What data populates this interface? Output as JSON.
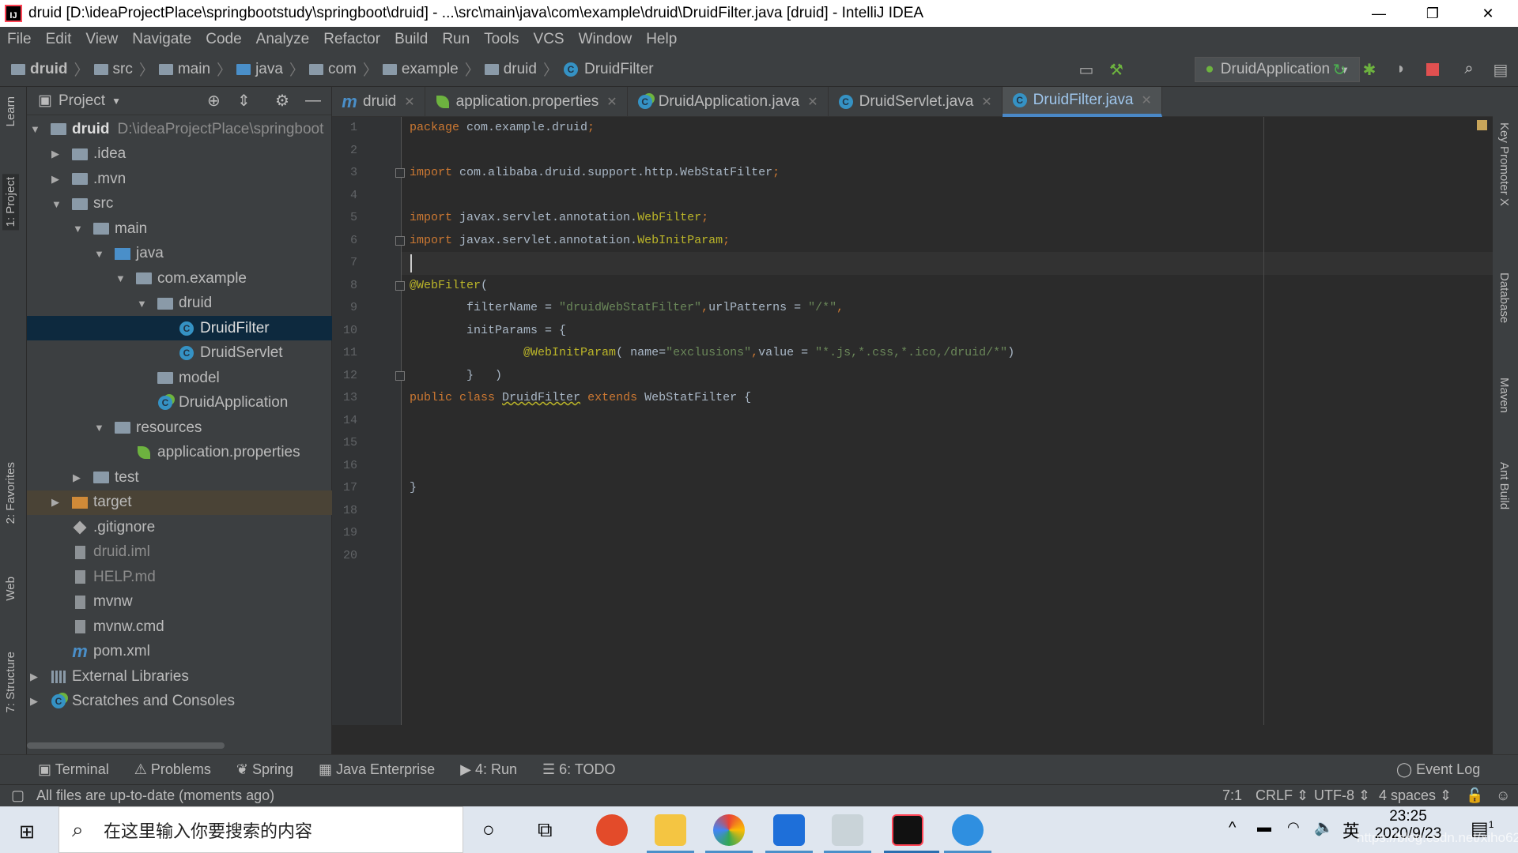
{
  "window": {
    "title": "druid [D:\\ideaProjectPlace\\springbootstudy\\springboot\\druid] - ...\\src\\main\\java\\com\\example\\druid\\DruidFilter.java [druid] - IntelliJ IDEA",
    "minimize": "—",
    "restore": "❐",
    "close": "✕"
  },
  "menu": [
    "File",
    "Edit",
    "View",
    "Navigate",
    "Code",
    "Analyze",
    "Refactor",
    "Build",
    "Run",
    "Tools",
    "VCS",
    "Window",
    "Help"
  ],
  "breadcrumbs": [
    "druid",
    "src",
    "main",
    "java",
    "com",
    "example",
    "druid",
    "DruidFilter"
  ],
  "run_config": "DruidApplication",
  "toolbar_icons": [
    "build-hammer-icon",
    "rerun-icon",
    "debug-icon",
    "coverage-icon",
    "stop-icon",
    "search-icon",
    "project-structure-icon"
  ],
  "left_strip": [
    "Learn",
    "1: Project",
    "2: Favorites",
    "Web",
    "7: Structure"
  ],
  "right_strip": [
    "Key Promoter X",
    "Database",
    "Maven",
    "Ant Build"
  ],
  "project": {
    "title": "Project",
    "tree": [
      {
        "d": 0,
        "a": "▼",
        "i": "folder",
        "label": "druid",
        "extra": "D:\\ideaProjectPlace\\springboot",
        "bold": true
      },
      {
        "d": 1,
        "a": "▶",
        "i": "folder",
        "label": ".idea"
      },
      {
        "d": 1,
        "a": "▶",
        "i": "folder",
        "label": ".mvn"
      },
      {
        "d": 1,
        "a": "▼",
        "i": "folder",
        "label": "src"
      },
      {
        "d": 2,
        "a": "▼",
        "i": "folder",
        "label": "main"
      },
      {
        "d": 3,
        "a": "▼",
        "i": "bfolder",
        "label": "java"
      },
      {
        "d": 4,
        "a": "▼",
        "i": "folder",
        "label": "com.example"
      },
      {
        "d": 5,
        "a": "▼",
        "i": "folder",
        "label": "druid"
      },
      {
        "d": 6,
        "a": "",
        "i": "cls",
        "label": "DruidFilter",
        "sel": true
      },
      {
        "d": 6,
        "a": "",
        "i": "cls",
        "label": "DruidServlet"
      },
      {
        "d": 5,
        "a": "",
        "i": "folder",
        "label": "model"
      },
      {
        "d": 5,
        "a": "",
        "i": "spring",
        "label": "DruidApplication"
      },
      {
        "d": 3,
        "a": "▼",
        "i": "folder",
        "label": "resources"
      },
      {
        "d": 4,
        "a": "",
        "i": "leaf",
        "label": "application.properties"
      },
      {
        "d": 2,
        "a": "▶",
        "i": "folder",
        "label": "test"
      },
      {
        "d": 1,
        "a": "▶",
        "i": "ofolder",
        "label": "target",
        "tgt": true
      },
      {
        "d": 1,
        "a": "",
        "i": "git",
        "label": ".gitignore"
      },
      {
        "d": 1,
        "a": "",
        "i": "file",
        "label": "druid.iml",
        "grey": true
      },
      {
        "d": 1,
        "a": "",
        "i": "file",
        "label": "HELP.md",
        "grey": true
      },
      {
        "d": 1,
        "a": "",
        "i": "file",
        "label": "mvnw"
      },
      {
        "d": 1,
        "a": "",
        "i": "file",
        "label": "mvnw.cmd"
      },
      {
        "d": 1,
        "a": "",
        "i": "m",
        "label": "pom.xml"
      },
      {
        "d": 0,
        "a": "▶",
        "i": "lib",
        "label": "External Libraries"
      },
      {
        "d": 0,
        "a": "▶",
        "i": "spring",
        "label": "Scratches and Consoles"
      }
    ]
  },
  "tabs": [
    {
      "label": "druid",
      "icon": "maven-icon"
    },
    {
      "label": "application.properties",
      "icon": "spring-properties-icon"
    },
    {
      "label": "DruidApplication.java",
      "icon": "spring-class-icon"
    },
    {
      "label": "DruidServlet.java",
      "icon": "class-icon"
    },
    {
      "label": "DruidFilter.java",
      "icon": "class-icon",
      "active": true
    }
  ],
  "editor": {
    "lines": [
      [
        [
          "kw",
          "package "
        ],
        [
          "tx",
          "com.example.druid"
        ],
        [
          "kw",
          ";"
        ]
      ],
      [],
      [
        [
          "kw",
          "import "
        ],
        [
          "tx",
          "com.alibaba.druid.support.http.WebStatFilter"
        ],
        [
          "kw",
          ";"
        ]
      ],
      [],
      [
        [
          "kw",
          "import "
        ],
        [
          "tx",
          "javax.servlet.annotation."
        ],
        [
          "an",
          "WebFilter"
        ],
        [
          "kw",
          ";"
        ]
      ],
      [
        [
          "kw",
          "import "
        ],
        [
          "tx",
          "javax.servlet.annotation."
        ],
        [
          "an",
          "WebInitParam"
        ],
        [
          "kw",
          ";"
        ]
      ],
      [],
      [
        [
          "an",
          "@WebFilter"
        ],
        [
          "tx",
          "("
        ]
      ],
      [
        [
          "tx",
          "        filterName = "
        ],
        [
          "st",
          "\"druidWebStatFilter\""
        ],
        [
          "kw",
          ","
        ],
        [
          "tx",
          "urlPatterns = "
        ],
        [
          "st",
          "\"/*\""
        ],
        [
          "kw",
          ","
        ]
      ],
      [
        [
          "tx",
          "        initParams = {"
        ]
      ],
      [
        [
          "tx",
          "                "
        ],
        [
          "an",
          "@WebInitParam"
        ],
        [
          "tx",
          "( name="
        ],
        [
          "st",
          "\"exclusions\""
        ],
        [
          "kw",
          ","
        ],
        [
          "tx",
          "value = "
        ],
        [
          "st",
          "\"*.js,*.css,*.ico,/druid/*\""
        ],
        [
          "tx",
          ")"
        ]
      ],
      [
        [
          "tx",
          "        }   )"
        ]
      ],
      [
        [
          "kw",
          "public class "
        ],
        [
          "ul",
          "DruidFilter"
        ],
        [
          "kw",
          " extends "
        ],
        [
          "tx",
          "WebStatFilter {"
        ]
      ],
      [],
      [],
      [],
      [
        [
          "tx",
          "}"
        ]
      ],
      [],
      [],
      []
    ]
  },
  "bottom_tools": [
    "Terminal",
    "Problems",
    "Spring",
    "Java Enterprise",
    "4: Run",
    "6: TODO"
  ],
  "event_log": "Event Log",
  "status": {
    "message": "All files are up-to-date (moments ago)",
    "position": "7:1",
    "line_sep": "CRLF ⇕",
    "encoding": "UTF-8 ⇕",
    "indent": "4 spaces ⇕"
  },
  "taskbar": {
    "search_placeholder": "在这里输入你要搜索的内容",
    "time": "23:25",
    "date": "2020/9/23",
    "ime": "英",
    "notifications": "1",
    "watermark": "https://blog.csdn.net/xiho62"
  }
}
